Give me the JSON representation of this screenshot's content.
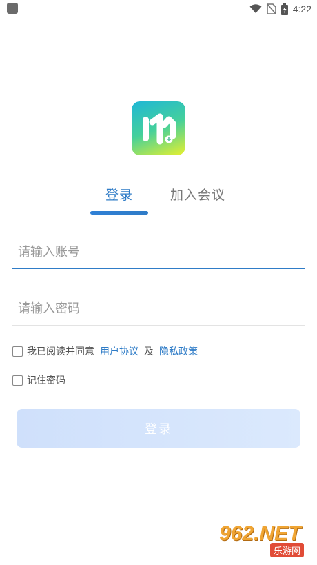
{
  "status_bar": {
    "time": "4:22"
  },
  "tabs": {
    "login": "登录",
    "join": "加入会议"
  },
  "form": {
    "account_placeholder": "请输入账号",
    "password_placeholder": "请输入密码",
    "agree_prefix": "我已阅读并同意",
    "user_agreement": "用户协议",
    "and": "及",
    "privacy_policy": "隐私政策",
    "remember_password": "记住密码",
    "login_button": "登录"
  },
  "watermark": {
    "main": "962.NET",
    "sub": "乐游网"
  },
  "colors": {
    "accent": "#2f7cc7",
    "button_bg": "#d6e6fc"
  }
}
